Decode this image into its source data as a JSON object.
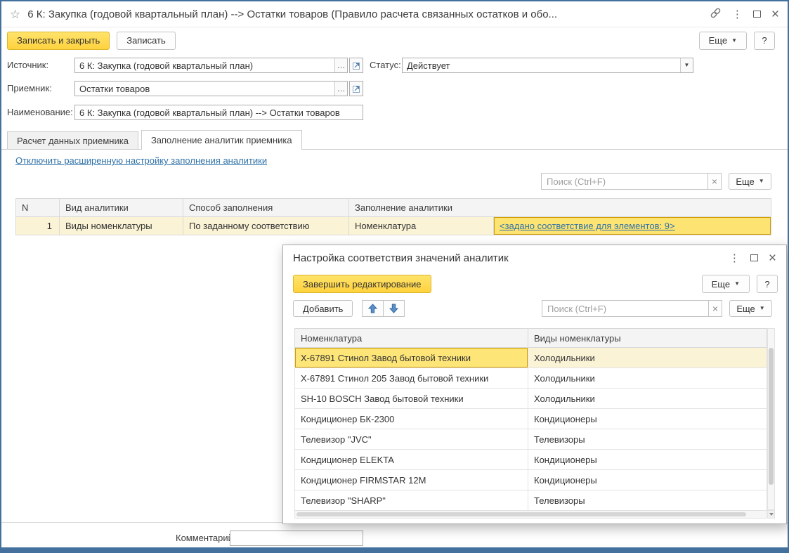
{
  "icons": {
    "star": "☆",
    "menu_dots": "⋮",
    "close": "×",
    "caret_down": "▼",
    "ellipsis": "…",
    "clear": "×"
  },
  "colors": {
    "accent_yellow": "#ffd23e",
    "selection_row": "#fbf3d6",
    "selection_cell": "#fde577",
    "selection_border": "#d09b00",
    "link_blue": "#3273a8",
    "window_border": "#44709e"
  },
  "window": {
    "title": "6 К: Закупка (годовой квартальный план) --> Остатки товаров (Правило расчета связанных остатков и обо...",
    "buttons": {
      "save_and_close": "Записать и закрыть",
      "save": "Записать",
      "more": "Еще",
      "help": "?"
    }
  },
  "form": {
    "source": {
      "label": "Источник:",
      "value": "6 К: Закупка (годовой квартальный план)"
    },
    "status": {
      "label": "Статус:",
      "value": "Действует"
    },
    "receiver": {
      "label": "Приемник:",
      "value": "Остатки товаров"
    },
    "name": {
      "label": "Наименование:",
      "value": "6 К: Закупка (годовой квартальный план) --> Остатки товаров"
    }
  },
  "tabs": {
    "calc": "Расчет данных приемника",
    "fill": "Заполнение аналитик приемника"
  },
  "panel": {
    "toggle_link": "Отключить расширенную настройку заполнения аналитики",
    "search_placeholder": "Поиск (Ctrl+F)",
    "more": "Еще",
    "table": {
      "headers": {
        "n": "N",
        "kind": "Вид аналитики",
        "method": "Способ заполнения",
        "fill": "Заполнение аналитики"
      },
      "row": {
        "n": "1",
        "kind": "Виды номенклатуры",
        "method": "По заданному соответствию",
        "fill": "Номенклатура",
        "link_text": "<задано соответствие для элементов: 9>"
      }
    }
  },
  "dialog": {
    "title": "Настройка соответствия значений аналитик",
    "finish_button": "Завершить редактирование",
    "more": "Еще",
    "help": "?",
    "add_button": "Добавить",
    "search_placeholder": "Поиск (Ctrl+F)",
    "table": {
      "headers": {
        "item": "Номенклатура",
        "kind": "Виды номенклатуры"
      },
      "rows": [
        {
          "item": "Х-67891 Стинол Завод бытовой техники",
          "kind": "Холодильники"
        },
        {
          "item": "Х-67891 Стинол 205 Завод бытовой техники",
          "kind": "Холодильники"
        },
        {
          "item": "SH-10 BOSCH Завод бытовой техники",
          "kind": "Холодильники"
        },
        {
          "item": "Кондиционер БК-2300",
          "kind": "Кондиционеры"
        },
        {
          "item": "Телевизор \"JVC\"",
          "kind": "Телевизоры"
        },
        {
          "item": "Кондиционер ELEKTA",
          "kind": "Кондиционеры"
        },
        {
          "item": "Кондиционер FIRMSTAR 12M",
          "kind": "Кондиционеры"
        },
        {
          "item": "Телевизор \"SHARP\"",
          "kind": "Телевизоры"
        }
      ]
    }
  },
  "footer": {
    "comment_label": "Комментарий:",
    "comment_value": ""
  }
}
